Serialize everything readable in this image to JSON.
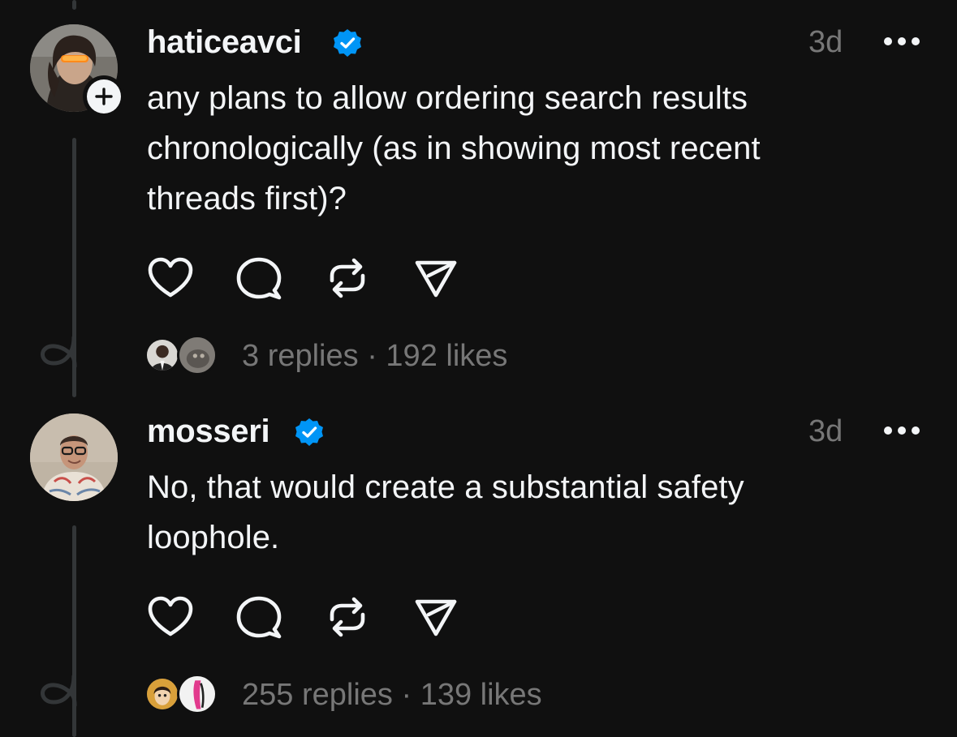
{
  "posts": [
    {
      "username": "haticeavci",
      "verified": true,
      "timestamp": "3d",
      "text": "any plans to allow ordering search results chronologically (as in showing most recent threads first)?",
      "replies": "3 replies",
      "separator": "·",
      "likes": "192 likes",
      "show_follow_badge": true
    },
    {
      "username": "mosseri",
      "verified": true,
      "timestamp": "3d",
      "text": "No, that would create a substantial safety loophole.",
      "replies": "255 replies",
      "separator": "·",
      "likes": "139 likes",
      "show_follow_badge": false
    }
  ],
  "icons": {
    "like": "heart-icon",
    "reply": "comment-icon",
    "repost": "repost-icon",
    "share": "send-icon",
    "more": "more-icon",
    "verified": "verified-badge-icon",
    "follow": "plus-icon"
  },
  "colors": {
    "background": "#101010",
    "text": "#f3f5f7",
    "secondary": "#777777",
    "verified": "#0095f6",
    "thread_line": "#333638"
  }
}
